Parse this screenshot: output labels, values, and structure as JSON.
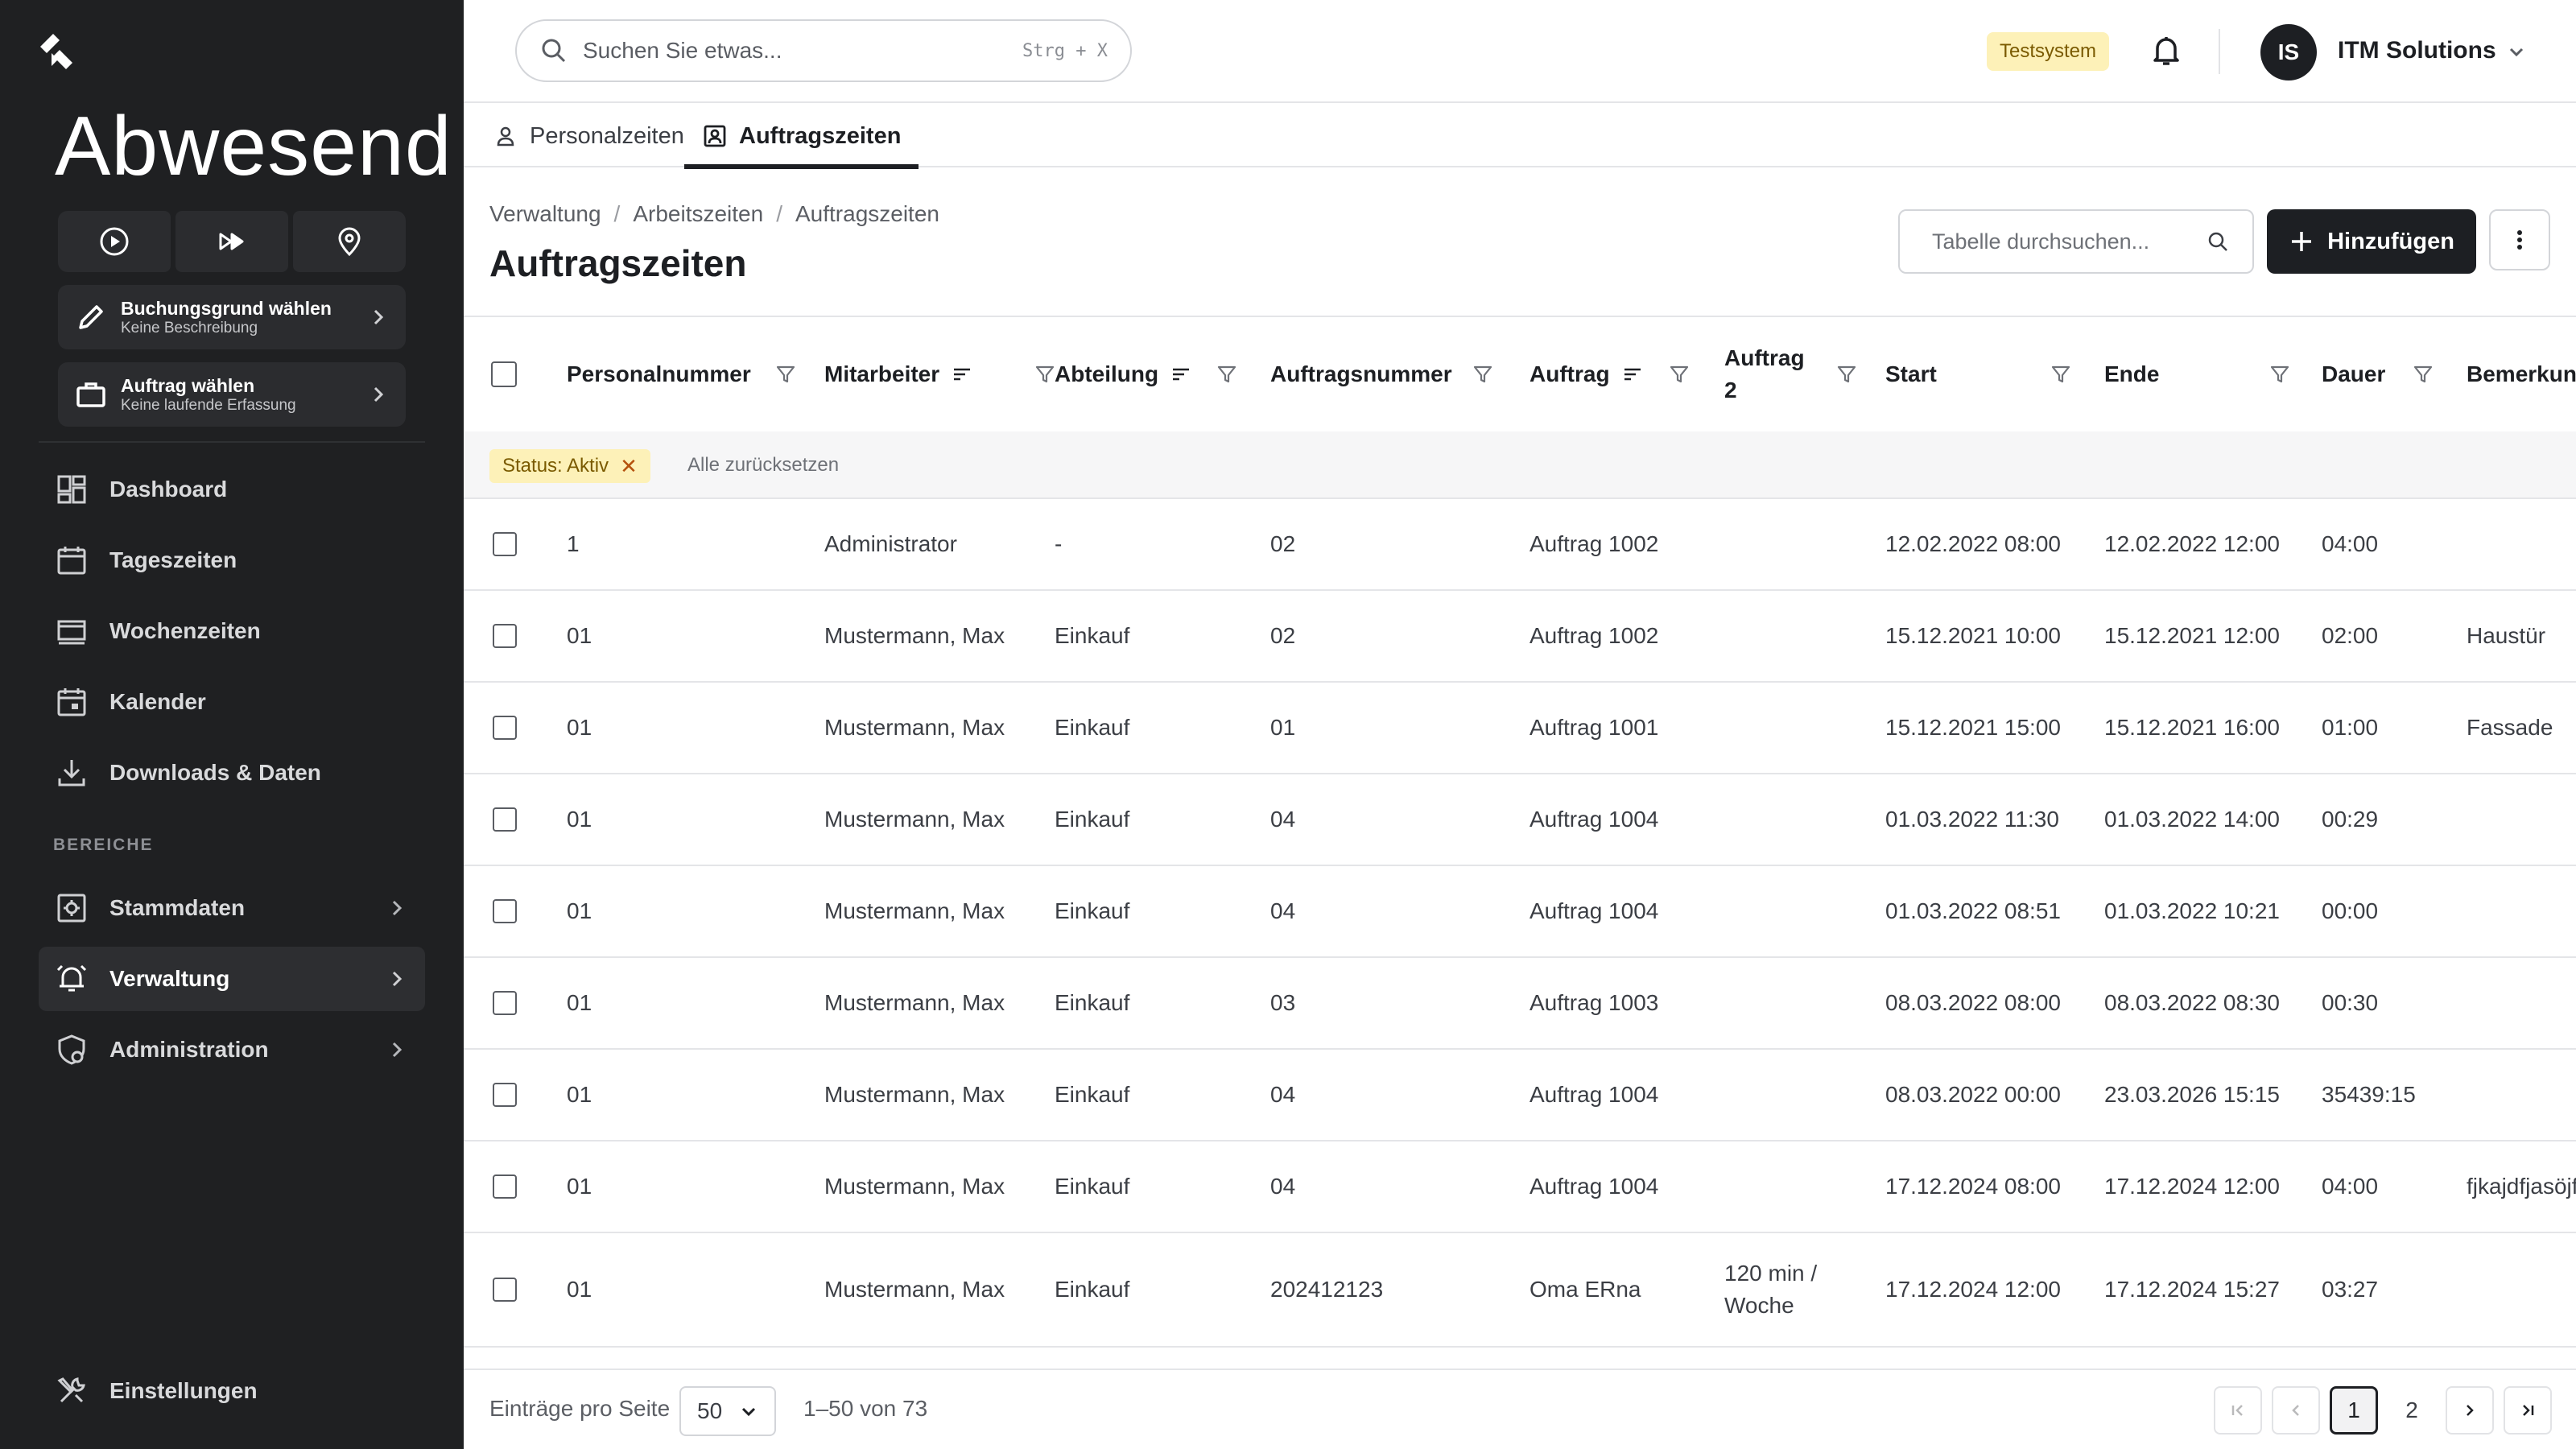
{
  "sidebar": {
    "status_title": "Abwesend",
    "cards": [
      {
        "title": "Buchungsgrund wählen",
        "subtitle": "Keine Beschreibung"
      },
      {
        "title": "Auftrag wählen",
        "subtitle": "Keine laufende Erfassung"
      }
    ],
    "nav": [
      "Dashboard",
      "Tageszeiten",
      "Wochenzeiten",
      "Kalender",
      "Downloads & Daten"
    ],
    "section_label": "BEREICHE",
    "areas": [
      "Stammdaten",
      "Verwaltung",
      "Administration"
    ],
    "settings": "Einstellungen"
  },
  "topbar": {
    "search_placeholder": "Suchen Sie etwas...",
    "shortcut": "Strg + X",
    "env_badge": "Testsystem",
    "avatar_initials": "IS",
    "org_name": "ITM Solutions"
  },
  "tabs": [
    "Personalzeiten",
    "Auftragszeiten"
  ],
  "page": {
    "breadcrumb": [
      "Verwaltung",
      "Arbeitszeiten",
      "Auftragszeiten"
    ],
    "title": "Auftragszeiten",
    "table_search_placeholder": "Tabelle durchsuchen...",
    "add_label": "Hinzufügen"
  },
  "table": {
    "columns": [
      "Personalnummer",
      "Mitarbeiter",
      "Abteilung",
      "Auftragsnummer",
      "Auftrag",
      "Auftrag 2",
      "Start",
      "Ende",
      "Dauer",
      "Bemerkung"
    ],
    "active_filter": "Status: Aktiv",
    "reset_all": "Alle zurücksetzen",
    "rows": [
      [
        "1",
        "Administrator",
        "-",
        "02",
        "Auftrag 1002",
        "",
        "12.02.2022 08:00",
        "12.02.2022 12:00",
        "04:00",
        ""
      ],
      [
        "01",
        "Mustermann, Max",
        "Einkauf",
        "02",
        "Auftrag 1002",
        "",
        "15.12.2021 10:00",
        "15.12.2021 12:00",
        "02:00",
        "Haustür"
      ],
      [
        "01",
        "Mustermann, Max",
        "Einkauf",
        "01",
        "Auftrag 1001",
        "",
        "15.12.2021 15:00",
        "15.12.2021 16:00",
        "01:00",
        "Fassade"
      ],
      [
        "01",
        "Mustermann, Max",
        "Einkauf",
        "04",
        "Auftrag 1004",
        "",
        "01.03.2022 11:30",
        "01.03.2022 14:00",
        "00:29",
        ""
      ],
      [
        "01",
        "Mustermann, Max",
        "Einkauf",
        "04",
        "Auftrag 1004",
        "",
        "01.03.2022 08:51",
        "01.03.2022 10:21",
        "00:00",
        ""
      ],
      [
        "01",
        "Mustermann, Max",
        "Einkauf",
        "03",
        "Auftrag 1003",
        "",
        "08.03.2022 08:00",
        "08.03.2022 08:30",
        "00:30",
        ""
      ],
      [
        "01",
        "Mustermann, Max",
        "Einkauf",
        "04",
        "Auftrag 1004",
        "",
        "08.03.2022 00:00",
        "23.03.2026 15:15",
        "35439:15",
        ""
      ],
      [
        "01",
        "Mustermann, Max",
        "Einkauf",
        "04",
        "Auftrag 1004",
        "",
        "17.12.2024 08:00",
        "17.12.2024 12:00",
        "04:00",
        "fjkajdfjasöjf"
      ],
      [
        "01",
        "Mustermann, Max",
        "Einkauf",
        "202412123",
        "Oma ERna",
        "120 min / Woche",
        "17.12.2024 12:00",
        "17.12.2024 15:27",
        "03:27",
        ""
      ]
    ]
  },
  "footer": {
    "per_page_label": "Einträge pro Seite",
    "per_page_value": "50",
    "range": "1–50 von 73",
    "pages": [
      "1",
      "2"
    ],
    "current_page": "1"
  }
}
